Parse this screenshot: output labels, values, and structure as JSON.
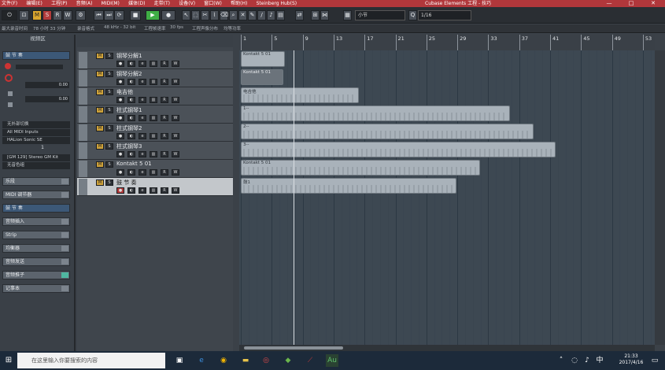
{
  "titlebar": {
    "menus": [
      "文件(F)",
      "编辑(E)",
      "工程(P)",
      "音频(A)",
      "MIDI(M)",
      "媒体(D)",
      "走带(T)",
      "设备(V)",
      "窗口(W)",
      "帮助(H)",
      "Steinberg Hub(S)"
    ],
    "title": "Cubase Elements 工程 - 技巧",
    "min": "—",
    "max": "□",
    "close": "✕"
  },
  "toolbar": {
    "m": "M",
    "s": "S",
    "r": "R",
    "w": "W",
    "snap_type": "小节",
    "quantize": "1/16"
  },
  "statusline": {
    "rec_time": "最大录音时间",
    "rec_value": "78 小时 33 分钟",
    "rec_format": "录音格式",
    "rec_format_value": "48 kHz - 32 bit",
    "frame_rate": "工程帧速率",
    "frame_value": "30 fps",
    "tempo": "工程声像分布",
    "tempo_value": "均等功率"
  },
  "inspector": {
    "header": "视频区",
    "track_name": "鼓 节 奏",
    "value1": "0.00",
    "value2": "0.00",
    "routing": [
      "无外部切换",
      "All MIDI Inputs",
      "HALion Sonic SE"
    ],
    "channel": "1",
    "program": "[GM 129] Stereo GM Kit",
    "patch": "无音色组",
    "sections": [
      "乐段",
      "MIDI 调节器",
      "鼓 节 奏",
      "音频插入",
      "Strip",
      "均衡器",
      "音频发送",
      "音频推子",
      "记事本"
    ]
  },
  "tracks": [
    {
      "name": "钢琴分解1"
    },
    {
      "name": "钢琴分解2"
    },
    {
      "name": "电吉他"
    },
    {
      "name": "柱式钢琴1"
    },
    {
      "name": "柱式钢琴2"
    },
    {
      "name": "柱式钢琴3"
    },
    {
      "name": "Kontakt 5 01"
    },
    {
      "name": "鼓 节 奏"
    }
  ],
  "ruler": [
    "1",
    "5",
    "9",
    "13",
    "17",
    "21",
    "25",
    "29",
    "33",
    "37",
    "41",
    "45",
    "49",
    "53"
  ],
  "parts": [
    {
      "label": "Kontakt 5 01"
    },
    {
      "label": "Kontakt 5 01"
    },
    {
      "label": "电吉他"
    },
    {
      "label": "1--"
    },
    {
      "label": "2--"
    },
    {
      "label": "3--"
    },
    {
      "label": "Kontakt 5 01"
    },
    {
      "label": "鼓1"
    }
  ],
  "taskbar": {
    "search_placeholder": "在这里输入你要搜索的内容",
    "time": "21:33",
    "date": "2017/4/16",
    "ime": "中"
  }
}
